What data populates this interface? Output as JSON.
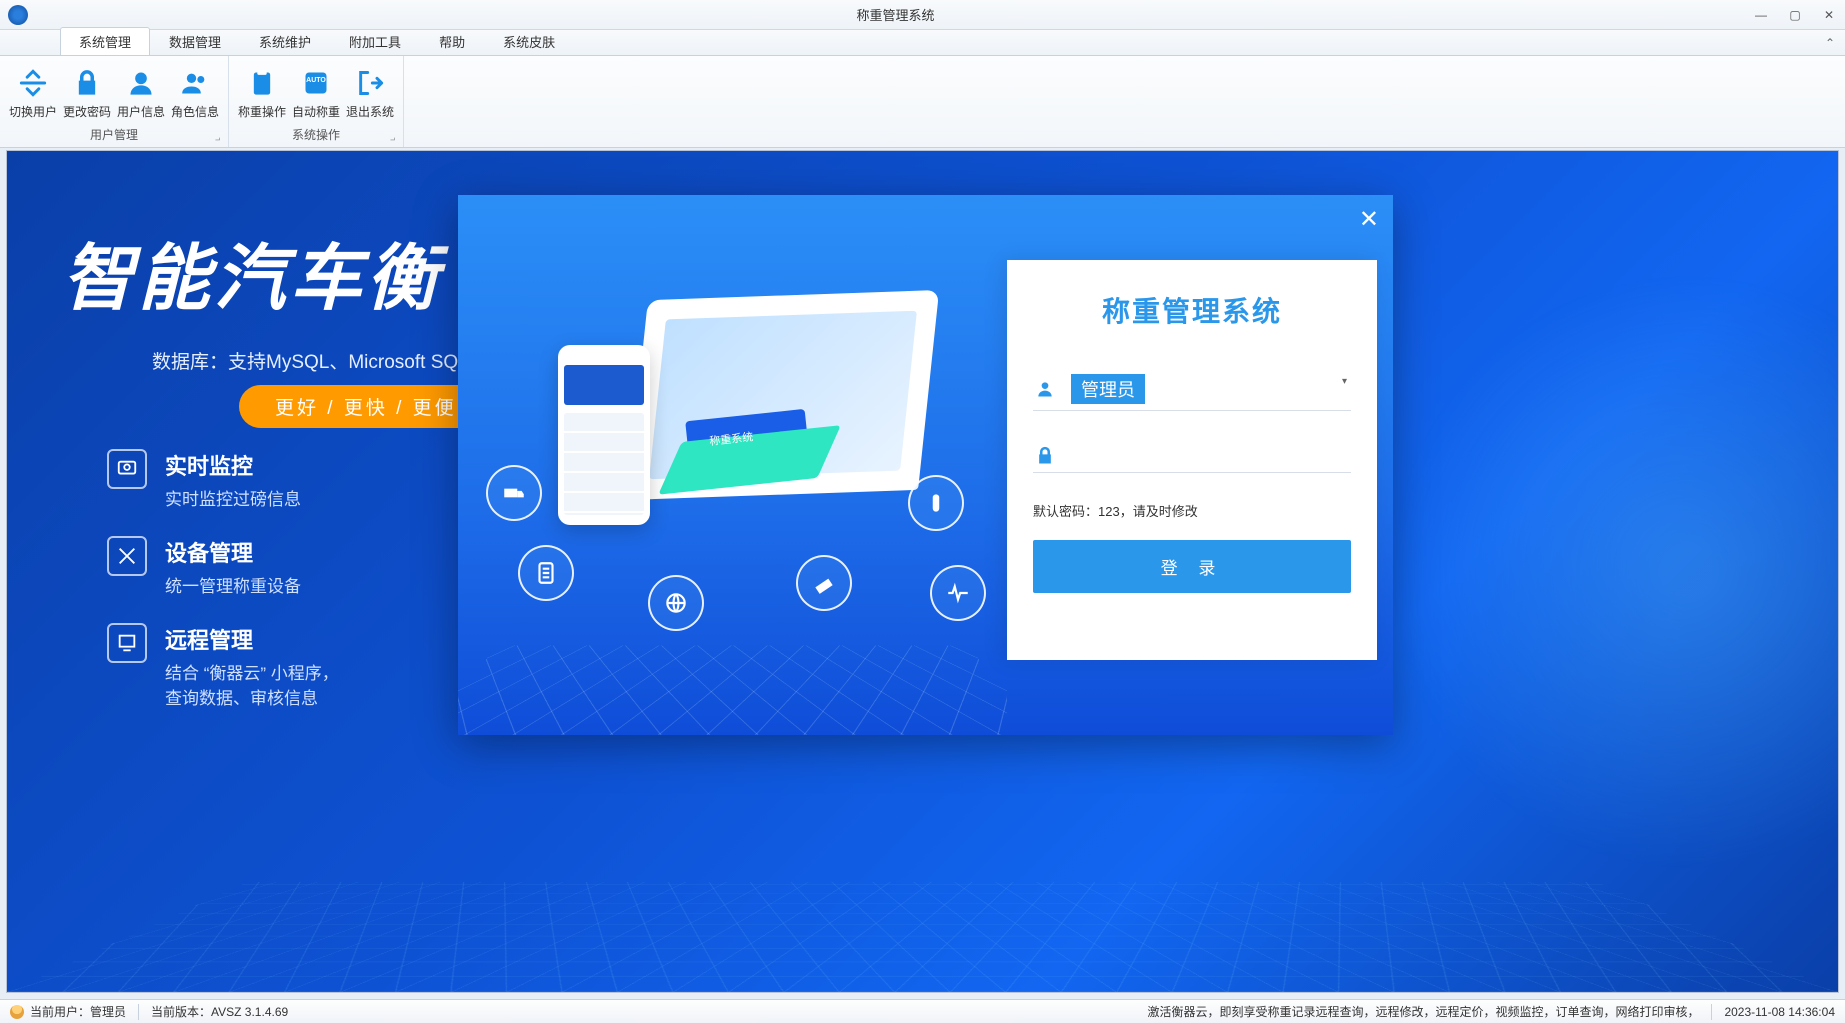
{
  "window": {
    "title": "称重管理系统"
  },
  "ribbon": {
    "tabs": [
      "系统管理",
      "数据管理",
      "系统维护",
      "附加工具",
      "帮助",
      "系统皮肤"
    ],
    "group1_title": "用户管理",
    "group2_title": "系统操作",
    "switch_user": "切换用户",
    "change_pwd": "更改密码",
    "user_info": "用户信息",
    "role_info": "角色信息",
    "weigh_op": "称重操作",
    "auto_weigh": "自动称重",
    "exit_sys": "退出系统"
  },
  "hero": {
    "headline": "智能汽车衡",
    "sub": "数据库：支持MySQL、Microsoft SQ",
    "pill": "更好 / 更快 / 更便",
    "f1_t": "实时监控",
    "f1_s": "实时监控过磅信息",
    "f2_t": "设备管理",
    "f2_s": "统一管理称重设备",
    "f3_t": "远程管理",
    "f3_s": "结合 “衡器云” 小程序，\n查询数据、审核信息"
  },
  "login": {
    "title": "称重管理系统",
    "username": "管理员",
    "password": "",
    "hint": "默认密码：123，请及时修改",
    "button": "登 录"
  },
  "status": {
    "user_label": "当前用户：管理员",
    "version_label": "当前版本：AVSZ 3.1.4.69",
    "scroll": "激活衡器云，即刻享受称重记录远程查询，远程修改，远程定价，视频监控，订单查询，网络打印审核，",
    "time": "2023-11-08 14:36:04"
  }
}
